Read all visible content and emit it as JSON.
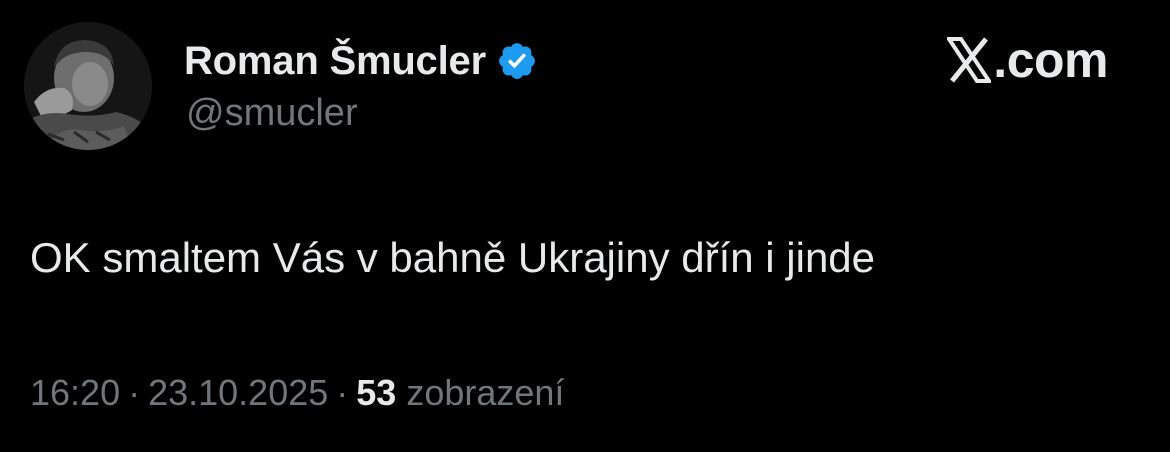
{
  "author": {
    "display_name": "Roman Šmucler",
    "handle": "@smucler",
    "verified": true,
    "avatar_icon": "profile-photo-icon"
  },
  "brand": {
    "icon": "x-logo-icon",
    "text": ".com"
  },
  "tweet": {
    "text": "OK smaltem Vás v bahně Ukrajiny dřín i jinde"
  },
  "meta": {
    "time": "16:20",
    "separator": "·",
    "date": "23.10.2025",
    "views_count": "53",
    "views_label": "zobrazení"
  },
  "colors": {
    "background": "#000000",
    "primary_text": "#e7e9ea",
    "secondary_text": "#71767b",
    "verified_blue": "#1d9bf0"
  }
}
